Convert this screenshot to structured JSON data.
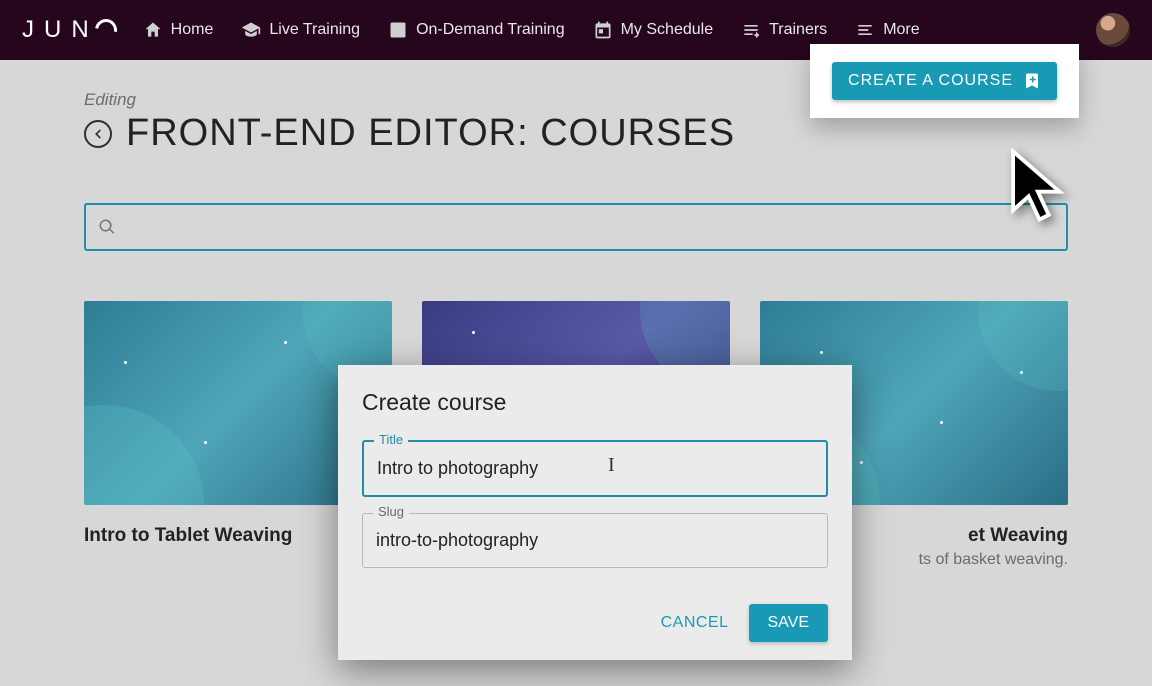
{
  "brand": "JUNO",
  "nav": {
    "home": "Home",
    "live": "Live Training",
    "ondemand": "On-Demand Training",
    "schedule": "My Schedule",
    "trainers": "Trainers",
    "more": "More"
  },
  "page": {
    "editing_label": "Editing",
    "title": "FRONT-END EDITOR: COURSES",
    "create_button": "CREATE A COURSE",
    "search_value": ""
  },
  "cards": [
    {
      "title": "Intro to Tablet Weaving",
      "subtitle": ""
    },
    {
      "title": "",
      "subtitle": ""
    },
    {
      "title": "et Weaving",
      "subtitle": "ts of basket weaving."
    }
  ],
  "modal": {
    "heading": "Create course",
    "title_label": "Title",
    "title_value": "Intro to photography",
    "slug_label": "Slug",
    "slug_value": "intro-to-photography",
    "cancel": "CANCEL",
    "save": "SAVE"
  }
}
